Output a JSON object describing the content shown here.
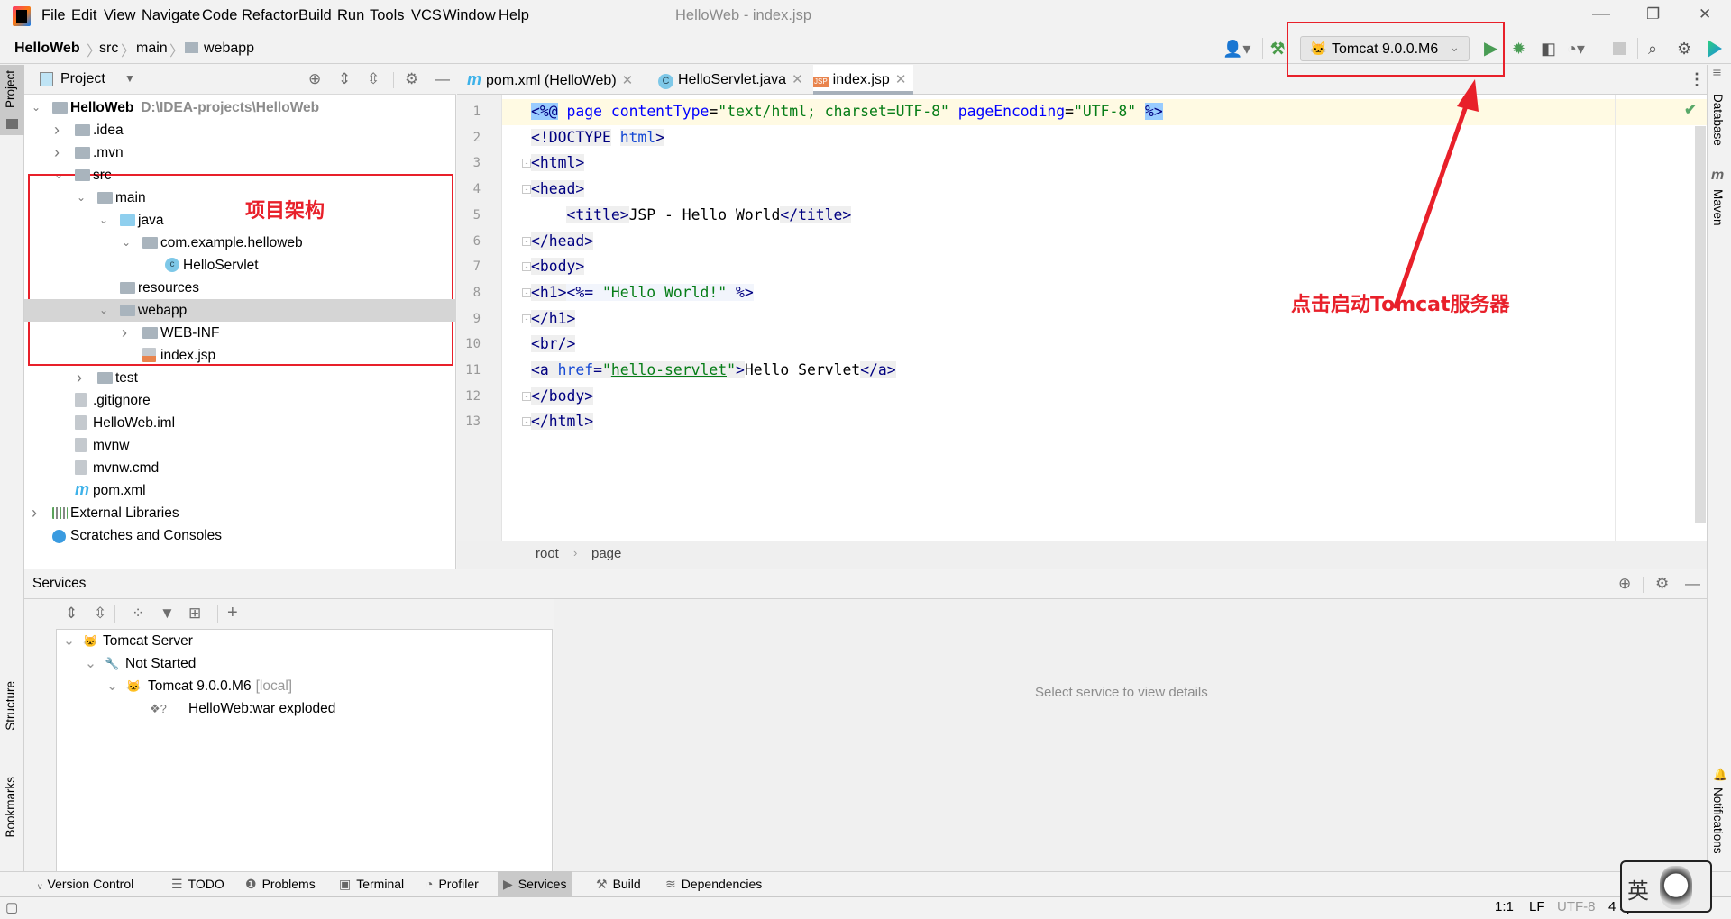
{
  "window": {
    "title": "HelloWeb - index.jsp",
    "menu": [
      "File",
      "Edit",
      "View",
      "Navigate",
      "Code",
      "Refactor",
      "Build",
      "Run",
      "Tools",
      "VCS",
      "Window",
      "Help"
    ],
    "controls": {
      "minimize": "—",
      "restore": "❐",
      "close": "✕"
    }
  },
  "breadcrumb": [
    "HelloWeb",
    "src",
    "main",
    "webapp"
  ],
  "toolbar": {
    "run_config": "Tomcat 9.0.0.M6",
    "icons": [
      "user-icon",
      "build-hammer-icon",
      "run-icon",
      "debug-icon",
      "coverage-icon",
      "profiler-icon",
      "stop-icon",
      "search-icon",
      "settings-gear-icon",
      "toolbox-logo-icon"
    ]
  },
  "annotations": {
    "tree_label": "项目架构",
    "run_label": "点击启动Tomcat服务器",
    "color": "#e8202a"
  },
  "left_strip": {
    "project": "Project",
    "structure": "Structure",
    "bookmarks": "Bookmarks"
  },
  "right_strip": {
    "database": "Database",
    "maven": "Maven",
    "notifications": "Notifications"
  },
  "project_panel": {
    "title": "Project",
    "tree": [
      {
        "label": "HelloWeb",
        "secondary": "D:\\IDEA-projects\\HelloWeb",
        "level": 0,
        "arrow": "down",
        "icon": "module",
        "bold": true
      },
      {
        "label": ".idea",
        "level": 1,
        "arrow": "right",
        "icon": "folder"
      },
      {
        "label": ".mvn",
        "level": 1,
        "arrow": "right",
        "icon": "folder"
      },
      {
        "label": "src",
        "level": 1,
        "arrow": "down",
        "icon": "folder"
      },
      {
        "label": "main",
        "level": 2,
        "arrow": "down",
        "icon": "folder"
      },
      {
        "label": "java",
        "level": 3,
        "arrow": "down",
        "icon": "source-folder"
      },
      {
        "label": "com.example.helloweb",
        "level": 4,
        "arrow": "down",
        "icon": "package"
      },
      {
        "label": "HelloServlet",
        "level": 5,
        "icon": "class"
      },
      {
        "label": "resources",
        "level": 3,
        "icon": "resources-folder"
      },
      {
        "label": "webapp",
        "level": 3,
        "arrow": "down",
        "icon": "web-folder",
        "selected": true
      },
      {
        "label": "WEB-INF",
        "level": 4,
        "arrow": "right",
        "icon": "folder"
      },
      {
        "label": "index.jsp",
        "level": 4,
        "icon": "jsp"
      },
      {
        "label": "test",
        "level": 2,
        "arrow": "right",
        "icon": "folder"
      },
      {
        "label": ".gitignore",
        "level": 1,
        "icon": "file"
      },
      {
        "label": "HelloWeb.iml",
        "level": 1,
        "icon": "file"
      },
      {
        "label": "mvnw",
        "level": 1,
        "icon": "file"
      },
      {
        "label": "mvnw.cmd",
        "level": 1,
        "icon": "file"
      },
      {
        "label": "pom.xml",
        "level": 1,
        "icon": "maven"
      },
      {
        "label": "External Libraries",
        "level": 0,
        "arrow": "right",
        "icon": "library"
      },
      {
        "label": "Scratches and Consoles",
        "level": 0,
        "icon": "scratch"
      }
    ]
  },
  "editor": {
    "tabs": [
      {
        "label": "pom.xml (HelloWeb)",
        "icon": "m"
      },
      {
        "label": "HelloServlet.java",
        "icon": "C"
      },
      {
        "label": "index.jsp",
        "icon": "JSP",
        "active": true
      }
    ],
    "lines": [
      [
        [
          "k",
          "<%@"
        ],
        [
          "p",
          " "
        ],
        [
          "a",
          "page"
        ],
        [
          "p",
          " "
        ],
        [
          "a",
          "contentType"
        ],
        [
          "p",
          "="
        ],
        [
          "s",
          "\"text/html; charset=UTF-8\""
        ],
        [
          "p",
          " "
        ],
        [
          "a",
          "pageEncoding"
        ],
        [
          "p",
          "="
        ],
        [
          "s",
          "\"UTF-8\""
        ],
        [
          "p",
          " "
        ],
        [
          "k",
          "%>"
        ]
      ],
      [
        [
          "t",
          "<!DOCTYPE"
        ],
        [
          "p",
          " "
        ],
        [
          "ta",
          "html"
        ],
        [
          "t",
          ">"
        ]
      ],
      [
        [
          "t",
          "<html>"
        ]
      ],
      [
        [
          "t",
          "<head>"
        ]
      ],
      [
        [
          "p",
          "    "
        ],
        [
          "t",
          "<title>"
        ],
        [
          "p",
          "JSP - Hello World"
        ],
        [
          "t",
          "</title>"
        ]
      ],
      [
        [
          "t",
          "</head>"
        ]
      ],
      [
        [
          "t",
          "<body>"
        ]
      ],
      [
        [
          "t",
          "<h1>"
        ],
        [
          "e",
          "<%="
        ],
        [
          "es",
          " \"Hello World!\""
        ],
        [
          "e",
          " %>"
        ]
      ],
      [
        [
          "t",
          "</h1>"
        ]
      ],
      [
        [
          "t",
          "<br/>"
        ]
      ],
      [
        [
          "t",
          "<a "
        ],
        [
          "ta",
          "href"
        ],
        [
          "t",
          "="
        ],
        [
          "ts",
          "\""
        ],
        [
          "tsu",
          "hello-servlet"
        ],
        [
          "ts",
          "\""
        ],
        [
          "t",
          ">"
        ],
        [
          "p",
          "Hello Servlet"
        ],
        [
          "t",
          "</a>"
        ]
      ],
      [
        [
          "t",
          "</body>"
        ]
      ],
      [
        [
          "t",
          "</html>"
        ]
      ]
    ],
    "folds": [
      3,
      4,
      6,
      7,
      8,
      9,
      12,
      13
    ],
    "crumbs": [
      "root",
      "page"
    ]
  },
  "services": {
    "title": "Services",
    "tree": [
      {
        "label": "Tomcat Server",
        "arrow": "down",
        "icon": "tomcat"
      },
      {
        "label": "Not Started",
        "arrow": "down",
        "icon": "wrench"
      },
      {
        "label": "Tomcat 9.0.0.M6",
        "secondary": "[local]",
        "arrow": "down",
        "icon": "tomcat"
      },
      {
        "label": "HelloWeb:war exploded",
        "icon": "artifact-unknown"
      }
    ],
    "empty_text": "Select service to view details"
  },
  "tool_windows": [
    {
      "label": "Version Control",
      "icon": "ᵥ"
    },
    {
      "label": "TODO",
      "icon": "☰"
    },
    {
      "label": "Problems",
      "icon": "❶"
    },
    {
      "label": "Terminal",
      "icon": "▣"
    },
    {
      "label": "Profiler",
      "icon": "◔"
    },
    {
      "label": "Services",
      "icon": "▶",
      "active": true
    },
    {
      "label": "Build",
      "icon": "⚒"
    },
    {
      "label": "Dependencies",
      "icon": "≋"
    }
  ],
  "status": {
    "position": "1:1",
    "line_sep": "LF",
    "encoding": "UTF-8",
    "indent": "4 spaces",
    "ime": "英"
  }
}
